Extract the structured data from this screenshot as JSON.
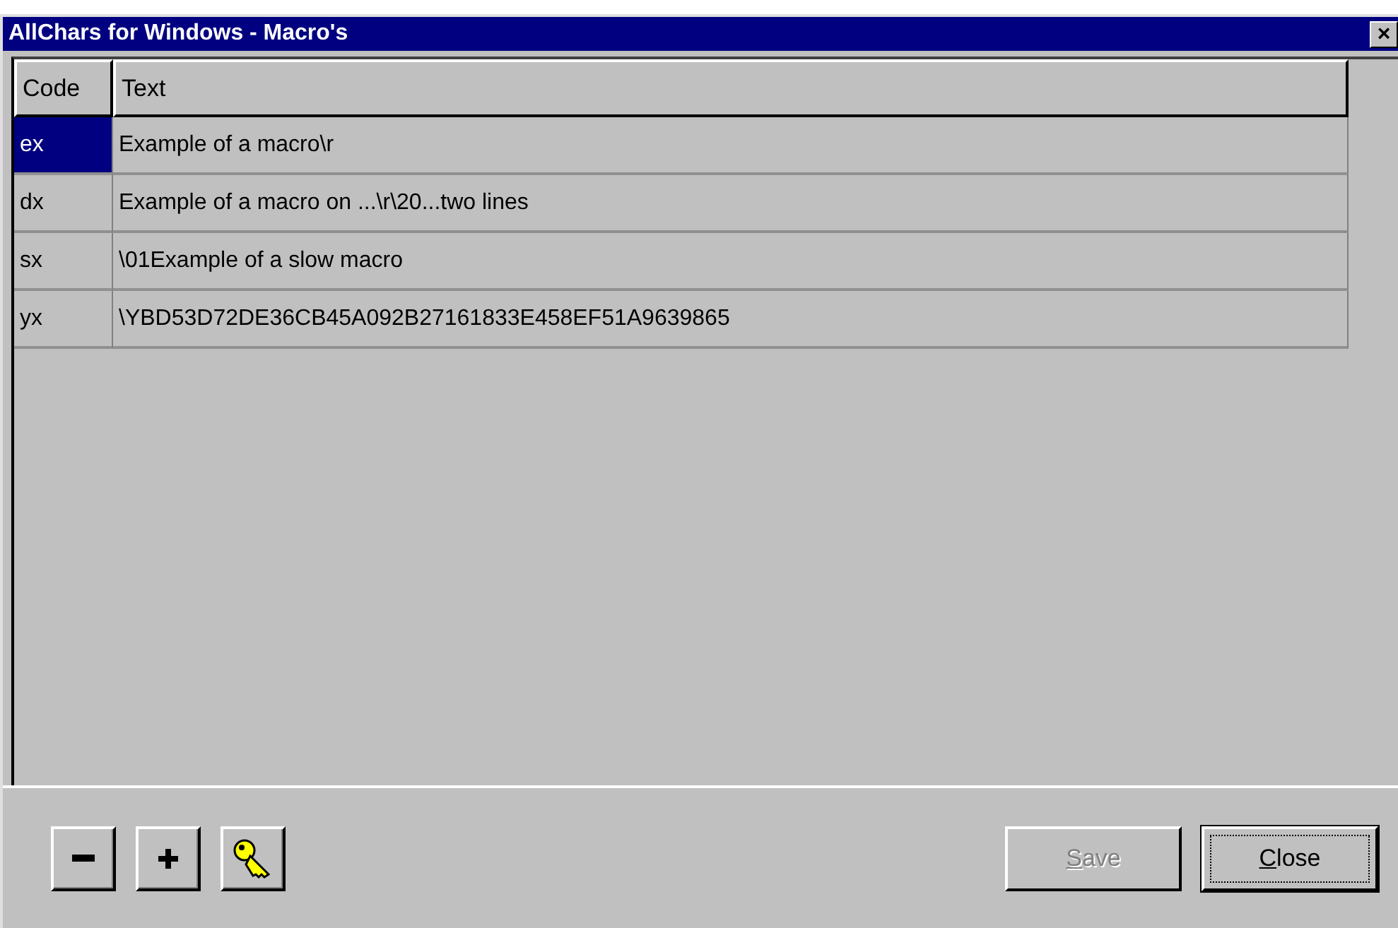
{
  "window": {
    "title": "AllChars for Windows - Macro's",
    "close_glyph": "×"
  },
  "table": {
    "columns": [
      "Code",
      "Text"
    ],
    "rows": [
      {
        "code": "ex",
        "text": "Example of a macro\\r",
        "selected": true
      },
      {
        "code": "dx",
        "text": "Example of a macro on ...\\r\\20...two lines",
        "selected": false
      },
      {
        "code": "sx",
        "text": "\\01Example of a slow macro",
        "selected": false
      },
      {
        "code": "yx",
        "text": "\\YBD53D72DE36CB45A092B27161833E458EF51A9639865",
        "selected": false
      }
    ]
  },
  "toolbar": [
    {
      "kind": "minus"
    },
    {
      "kind": "plus"
    },
    {
      "kind": "key"
    }
  ],
  "buttons": [
    {
      "label": "Save",
      "disabled": true,
      "default": false
    },
    {
      "label": "Close",
      "disabled": false,
      "default": true
    }
  ]
}
